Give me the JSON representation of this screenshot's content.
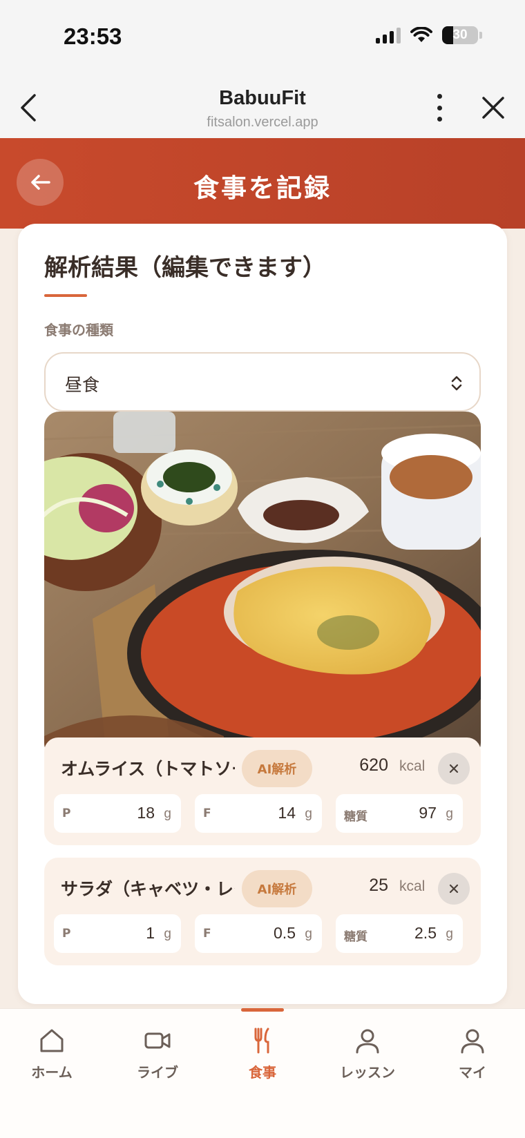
{
  "status": {
    "time": "23:53",
    "battery": "30"
  },
  "browser": {
    "title": "BabuuFit",
    "url": "fitsalon.vercel.app"
  },
  "header": {
    "title": "食事を記録"
  },
  "card": {
    "title": "解析結果（編集できます）",
    "meal_type_label": "食事の種類",
    "meal_type_value": "昼食"
  },
  "foods": [
    {
      "name": "オムライス（トマトソース）",
      "badge": "AI解析",
      "kcal": "620",
      "kcal_unit": "kcal",
      "macros": [
        {
          "label": "P",
          "value": "18",
          "unit": "g"
        },
        {
          "label": "F",
          "value": "14",
          "unit": "g"
        },
        {
          "label": "糖質",
          "value": "97",
          "unit": "g"
        }
      ]
    },
    {
      "name": "サラダ（キャベツ・レタス）",
      "badge": "AI解析",
      "kcal": "25",
      "kcal_unit": "kcal",
      "macros": [
        {
          "label": "P",
          "value": "1",
          "unit": "g"
        },
        {
          "label": "F",
          "value": "0.5",
          "unit": "g"
        },
        {
          "label": "糖質",
          "value": "2.5",
          "unit": "g"
        }
      ]
    }
  ],
  "nav": {
    "items": [
      {
        "label": "ホーム",
        "icon": "home-icon",
        "active": false
      },
      {
        "label": "ライブ",
        "icon": "video-icon",
        "active": false
      },
      {
        "label": "食事",
        "icon": "utensils-icon",
        "active": true
      },
      {
        "label": "レッスン",
        "icon": "person-icon",
        "active": false
      },
      {
        "label": "マイ",
        "icon": "person-icon",
        "active": false
      }
    ]
  },
  "colors": {
    "accent": "#d9663b",
    "header": "#c84a2c"
  }
}
